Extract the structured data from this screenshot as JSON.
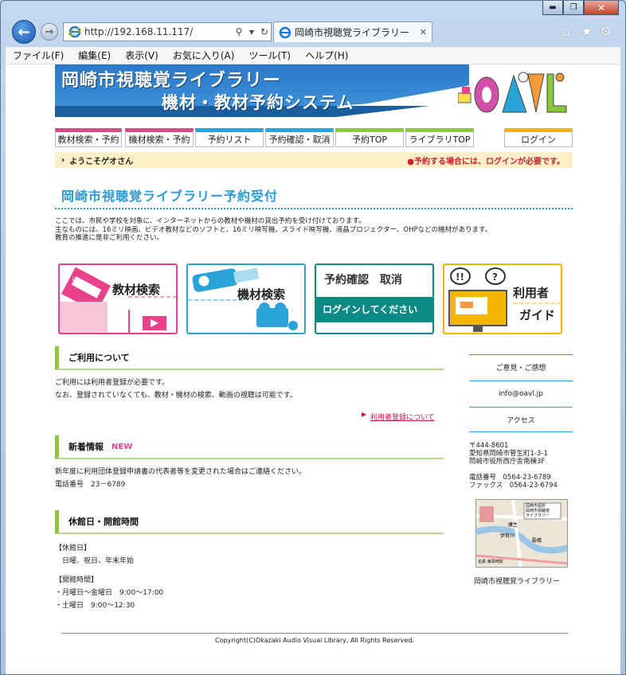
{
  "browser": {
    "url": "http://192.168.11.117/",
    "tab_title": "岡崎市視聴覚ライブラリー",
    "menu": [
      "ファイル(F)",
      "編集(E)",
      "表示(V)",
      "お気に入り(A)",
      "ツール(T)",
      "ヘルプ(H)"
    ],
    "window_controls": {
      "minimize": "▬",
      "maximize": "❐",
      "close": "✕"
    },
    "icons": [
      "home-icon",
      "star-icon",
      "gear-icon"
    ]
  },
  "banner": {
    "line1": "岡崎市視聴覚ライブラリー",
    "line2": "機材・教材予約システム",
    "logo": "OAVL"
  },
  "nav": [
    {
      "label": "教材検索・予約",
      "color": "#e8428a"
    },
    {
      "label": "機材検索・予約",
      "color": "#e8428a"
    },
    {
      "label": "予約リスト",
      "color": "#2aa3d8"
    },
    {
      "label": "予約確認・取消",
      "color": "#2aa3d8"
    },
    {
      "label": "予約TOP",
      "color": "#8dc63f"
    },
    {
      "label": "ライブラリTOP",
      "color": "#8dc63f"
    },
    {
      "label": "ログイン",
      "color": "#f7b500"
    }
  ],
  "welcome": {
    "text": "ようこそゲオさん",
    "notice": "●予約する場合には、ログインが必要です。"
  },
  "heading": "岡崎市視聴覚ライブラリー予約受付",
  "intro": [
    "ここでは、市民や学校を対象に、インターネットからの教材や機材の貸出予約を受け付けております。",
    "主なものには、16ミリ映画、ビデオ教材などのソフトと、16ミリ映写機、スライド映写機、液晶プロジェクター、OHPなどの機材があります。",
    "教育の推進に是非ご利用ください。"
  ],
  "cards": {
    "materials": {
      "label": "教材検索",
      "badge": "VIDEO"
    },
    "equipment": {
      "label": "機材検索"
    },
    "reservation": {
      "top": "予約確認　取消",
      "login": "ログインしてください"
    },
    "guide": {
      "line1": "利用者",
      "line2": "ガイド"
    }
  },
  "sections": {
    "usage": {
      "title": "ご利用について",
      "lines": [
        "ご利用には利用者登録が必要です。",
        "なお、登録されていなくても、教材・機材の検索、動画の視聴は可能です。"
      ],
      "link": "利用者登録について"
    },
    "news": {
      "title": "新着情報",
      "badge": "NEW",
      "lines": [
        "新年度に利用団体登録申請書の代表者等を変更された場合はご連絡ください。",
        "電話番号　23－6789"
      ]
    },
    "hours": {
      "title": "休館日・開館時間",
      "lines": [
        "【休館日】",
        "　日曜、祝日、年末年始",
        "",
        "【開館時間】",
        "・月曜日～金曜日　9:00～17:00",
        "・土曜日　9:00～12:30"
      ]
    }
  },
  "sidebar": {
    "links": [
      "ご意見・ご感想",
      "info@oavl.jp",
      "アクセス"
    ],
    "address": [
      "〒444-8601",
      "愛知県岡崎市菅生町1-3-1",
      "岡崎市役所西庁舎南棟3F",
      "",
      "電話番号　0564-23-6789",
      "ファックス　0564-23-6794"
    ],
    "map_labels": [
      "岡崎市役所",
      "岡崎市視聴覚",
      "ライブラリー",
      "康生",
      "伊賀川",
      "殿橋",
      "名鉄 東岡崎駅"
    ],
    "map_caption": "岡崎市視聴覚ライブラリー"
  },
  "footer": "Copyright(C)Okazaki Audio Visual Library, All Rights Reserved."
}
